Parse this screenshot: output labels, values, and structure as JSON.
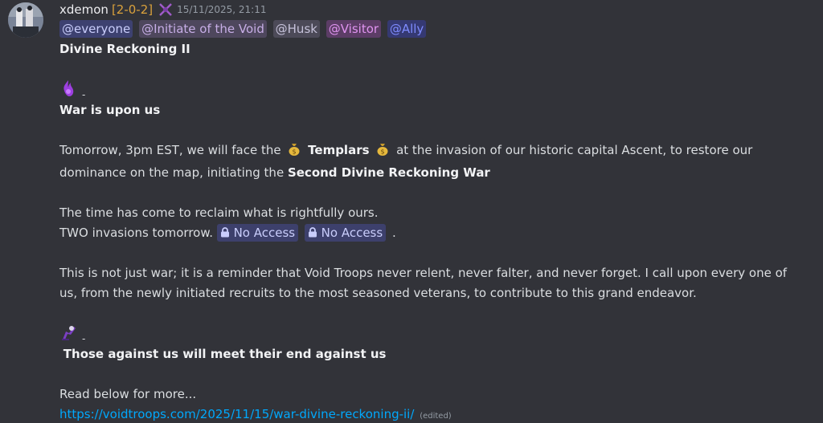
{
  "message": {
    "username": "xdemon",
    "clan_tag": "[2-0-2]",
    "timestamp": "15/11/2025, 21:11",
    "mentions": [
      "@everyone",
      "@Initiate of the Void",
      "@Husk",
      "@Visitor",
      "@Ally"
    ],
    "title": "Divine Reckoning II",
    "section1_heading": "War is upon us",
    "p1_start": "Tomorrow, 3pm EST, we will face the",
    "p1_bold1": "Templars",
    "p1_mid": "at the invasion of our historic capital Ascent, to restore our",
    "p1_line2_start": "dominance on the map, initiating the",
    "p1_bold2": "Second Divine Reckoning War",
    "p2_line1": "The time has come to reclaim what is rightfully ours.",
    "p2_line2_start": "TWO invasions tomorrow.",
    "no_access_1": "No Access",
    "no_access_2": "No Access",
    "p2_end": ".",
    "p3_line1": "This is not just war; it is a reminder that Void Troops never relent, never falter, and never forget. I call upon every one of",
    "p3_line2": "us, from the newly initiated recruits to the most seasoned veterans, to contribute to this grand endeavor.",
    "section2_heading": "Those against us will meet their end against us",
    "p4": "Read below for more...",
    "link": "https://voidtroops.com/2025/11/15/war-divine-reckoning-ii/",
    "edited": "(edited)",
    "emoji_dash": "-"
  }
}
